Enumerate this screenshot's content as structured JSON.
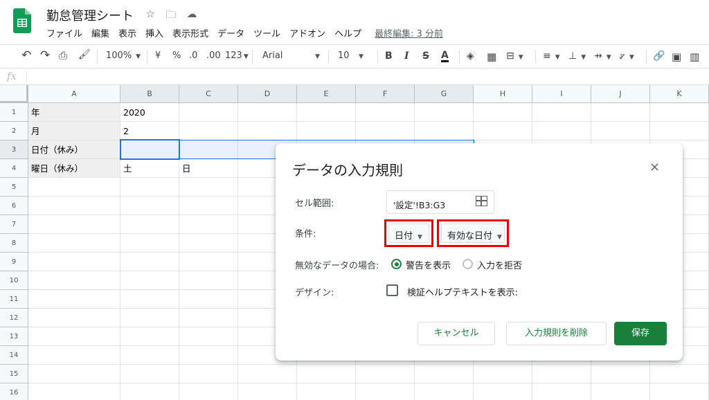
{
  "app": {
    "doc_title": "勤怠管理シート",
    "menu": [
      "ファイル",
      "編集",
      "表示",
      "挿入",
      "表示形式",
      "データ",
      "ツール",
      "アドオン",
      "ヘルプ"
    ],
    "last_edit": "最終編集: 3 分前"
  },
  "toolbar": {
    "zoom": "100%",
    "currency": "¥",
    "percent": "%",
    "dec_less": ".0",
    "dec_more": ".00",
    "format_more": "123",
    "font": "Arial",
    "font_size": "10",
    "bold": "B",
    "italic": "I",
    "strike": "S",
    "text_color": "A"
  },
  "formula_bar": {
    "fx": "fx"
  },
  "sheet": {
    "columns": [
      "A",
      "B",
      "C",
      "D",
      "E",
      "F",
      "G",
      "H",
      "I",
      "J",
      "K"
    ],
    "rows": [
      "1",
      "2",
      "3",
      "4",
      "5",
      "6",
      "7",
      "8",
      "9",
      "10",
      "11",
      "12",
      "13",
      "14",
      "15",
      "16"
    ],
    "cells": {
      "A1": "年",
      "B1": "2020",
      "A2": "月",
      "B2": "2",
      "A3": "日付（休み）",
      "A4": "曜日（休み）",
      "B4": "土",
      "C4": "日"
    }
  },
  "dialog": {
    "title": "データの入力規則",
    "close": "×",
    "range_label": "セル範囲:",
    "range_value": "'設定'!B3:G3",
    "criteria_label": "条件:",
    "criteria_type": "日付",
    "criteria_condition": "有効な日付",
    "invalid_label": "無効なデータの場合:",
    "invalid_options": [
      "警告を表示",
      "入力を拒否"
    ],
    "invalid_selected": "警告を表示",
    "design_label": "デザイン:",
    "help_text_option": "検証ヘルプテキストを表示:",
    "help_text_checked": false,
    "buttons": {
      "cancel": "キャンセル",
      "remove": "入力規則を削除",
      "save": "保存"
    },
    "highlight_color": "#ee0000",
    "accent_color": "#188038"
  }
}
